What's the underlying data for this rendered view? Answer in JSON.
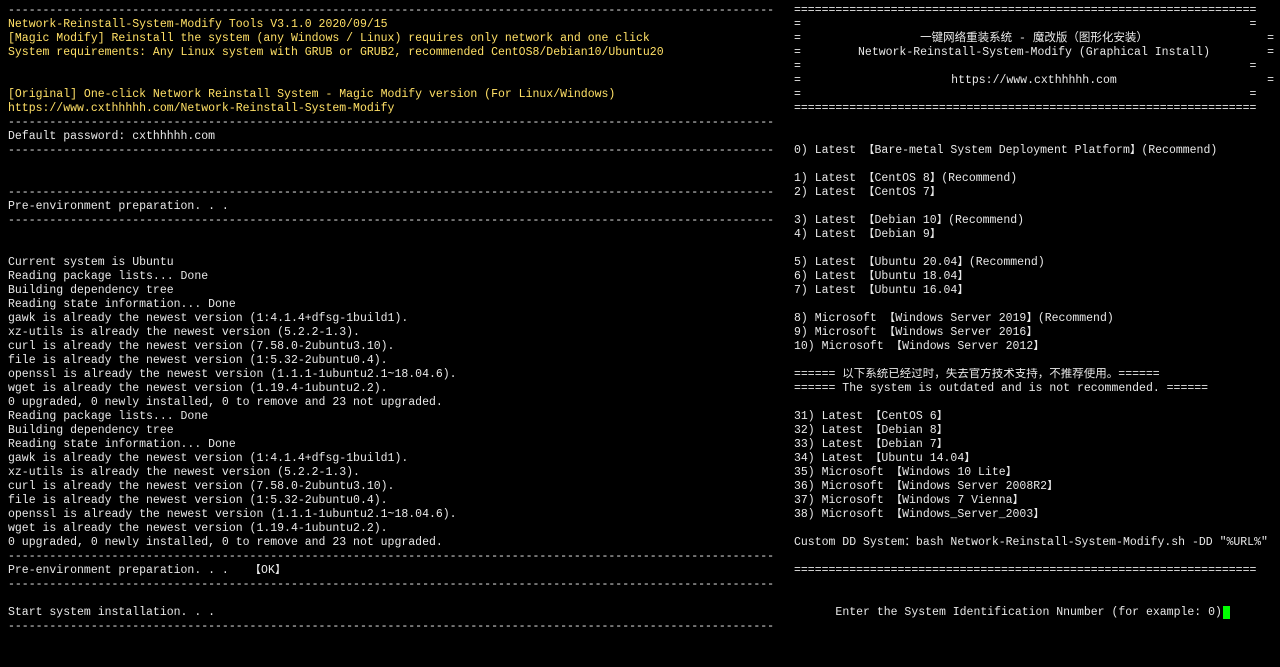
{
  "left": {
    "title1": "Network-Reinstall-System-Modify Tools V3.1.0 2020/09/15",
    "title2": "[Magic Modify] Reinstall the system (any Windows / Linux) requires only network and one click",
    "title3": "System requirements: Any Linux system with GRUB or GRUB2, recommended CentOS8/Debian10/Ubuntu20",
    "orig1": "[Original] One-click Network Reinstall System - Magic Modify version (For Linux/Windows)",
    "orig2": "https://www.cxthhhhh.com/Network-Reinstall-System-Modify",
    "default_pw": "Default password: cxthhhhh.com",
    "preenv": "Pre-environment preparation. . .",
    "preenv_ok": "Pre-environment preparation. . .   【OK】",
    "start_install": "Start system installation. . .",
    "log": [
      "Current system is Ubuntu",
      "Reading package lists... Done",
      "Building dependency tree",
      "Reading state information... Done",
      "gawk is already the newest version (1:4.1.4+dfsg-1build1).",
      "xz-utils is already the newest version (5.2.2-1.3).",
      "curl is already the newest version (7.58.0-2ubuntu3.10).",
      "file is already the newest version (1:5.32-2ubuntu0.4).",
      "openssl is already the newest version (1.1.1-1ubuntu2.1~18.04.6).",
      "wget is already the newest version (1.19.4-1ubuntu2.2).",
      "0 upgraded, 0 newly installed, 0 to remove and 23 not upgraded.",
      "Reading package lists... Done",
      "Building dependency tree",
      "Reading state information... Done",
      "gawk is already the newest version (1:4.1.4+dfsg-1build1).",
      "xz-utils is already the newest version (5.2.2-1.3).",
      "curl is already the newest version (7.58.0-2ubuntu3.10).",
      "file is already the newest version (1:5.32-2ubuntu0.4).",
      "openssl is already the newest version (1.1.1-1ubuntu2.1~18.04.6).",
      "wget is already the newest version (1.19.4-1ubuntu2.2).",
      "0 upgraded, 0 newly installed, 0 to remove and 23 not upgraded."
    ]
  },
  "right": {
    "header1_cn": "一键网络重装系统 - 魔改版（图形化安装）",
    "header2_en": "Network-Reinstall-System-Modify (Graphical Install)",
    "header_url": "https://www.cxthhhhh.com",
    "options": [
      "0) Latest 【Bare-metal System Deployment Platform】(Recommend)",
      "",
      "1) Latest 【CentOS 8】(Recommend)",
      "2) Latest 【CentOS 7】",
      "",
      "3) Latest 【Debian 10】(Recommend)",
      "4) Latest 【Debian 9】",
      "",
      "5) Latest 【Ubuntu 20.04】(Recommend)",
      "6) Latest 【Ubuntu 18.04】",
      "7) Latest 【Ubuntu 16.04】",
      "",
      "8) Microsoft 【Windows Server 2019】(Recommend)",
      "9) Microsoft 【Windows Server 2016】",
      "10) Microsoft 【Windows Server 2012】",
      "",
      "====== 以下系统已经过时，失去官方技术支持，不推荐使用。======",
      "====== The system is outdated and is not recommended. ======",
      "",
      "31) Latest 【CentOS 6】",
      "32) Latest 【Debian 8】",
      "33) Latest 【Debian 7】",
      "34) Latest 【Ubuntu 14.04】",
      "35) Microsoft 【Windows 10 Lite】",
      "36) Microsoft 【Windows Server 2008R2】",
      "37) Microsoft 【Windows 7 Vienna】",
      "38) Microsoft 【Windows_Server_2003】",
      "",
      "Custom DD System：bash Network-Reinstall-System-Modify.sh -DD \"%URL%\""
    ],
    "prompt": "Enter the System Identification Nnumber (for example: 0)"
  }
}
